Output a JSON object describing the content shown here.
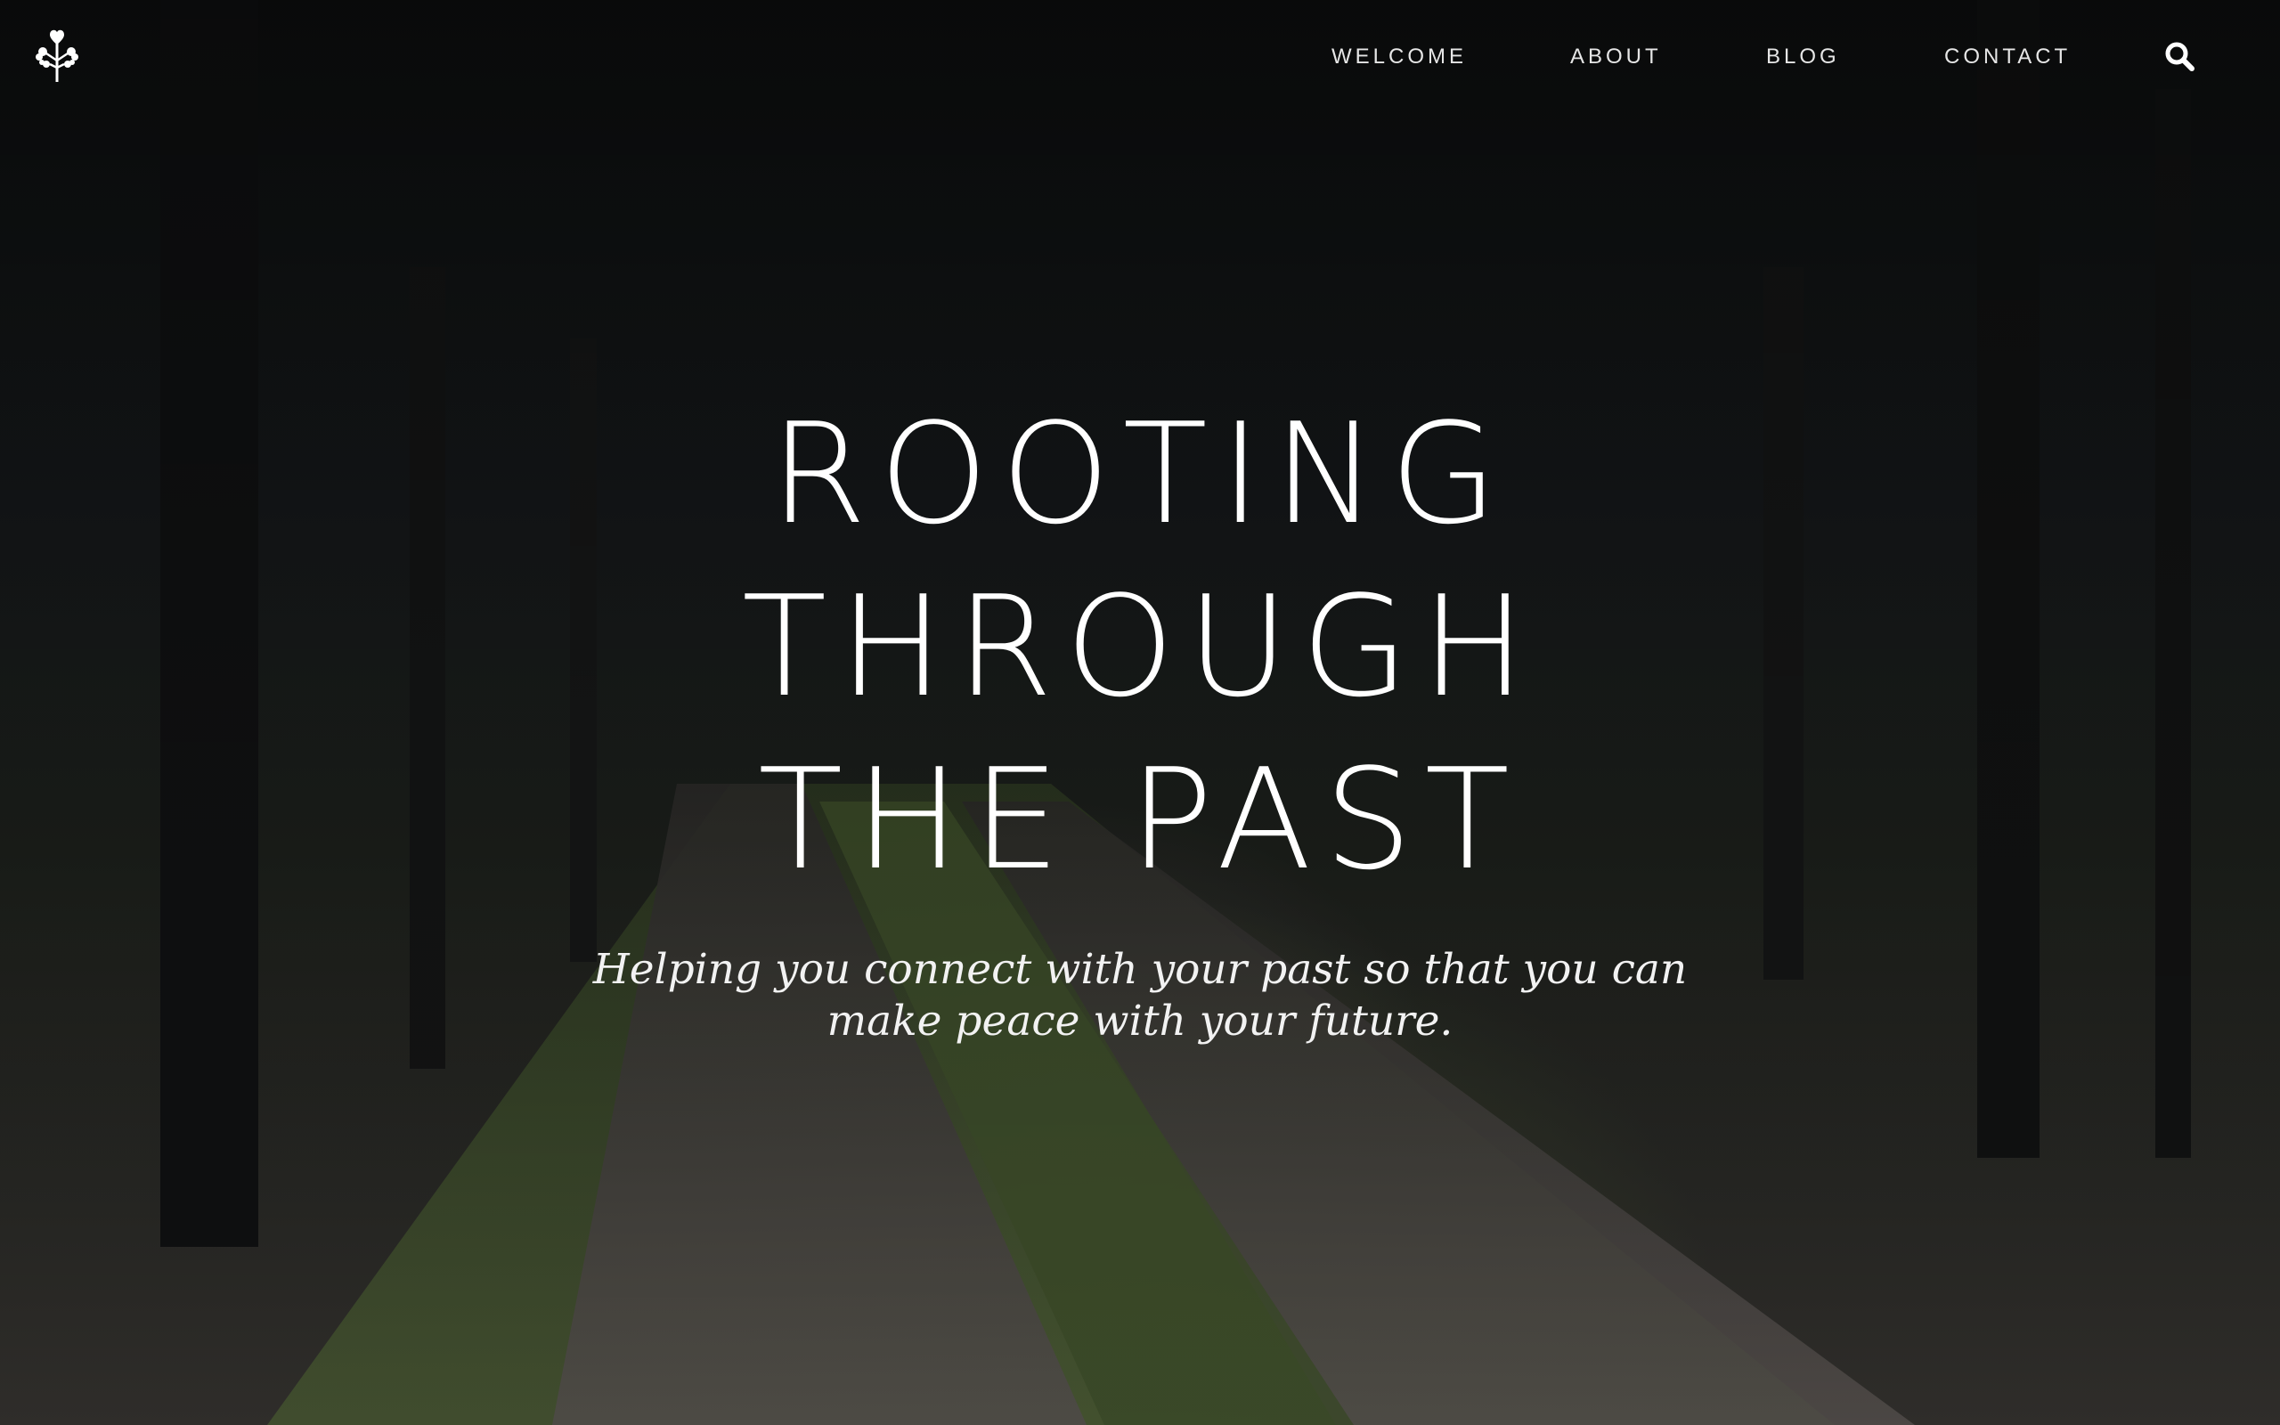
{
  "nav": {
    "items": [
      {
        "label": "WELCOME"
      },
      {
        "label": "ABOUT"
      },
      {
        "label": "BLOG"
      },
      {
        "label": "CONTACT"
      }
    ],
    "search_icon": "search-icon"
  },
  "logo": {
    "icon": "heart-tree-icon"
  },
  "hero": {
    "title_lines": [
      "ROOTING",
      "THROUGH",
      "THE PAST"
    ],
    "subtitle": "Helping you connect with your past so that you can make peace with your future."
  },
  "colors": {
    "text": "#ffffff",
    "nav_text": "#e6e6e6",
    "background": "#0d0d0f"
  }
}
